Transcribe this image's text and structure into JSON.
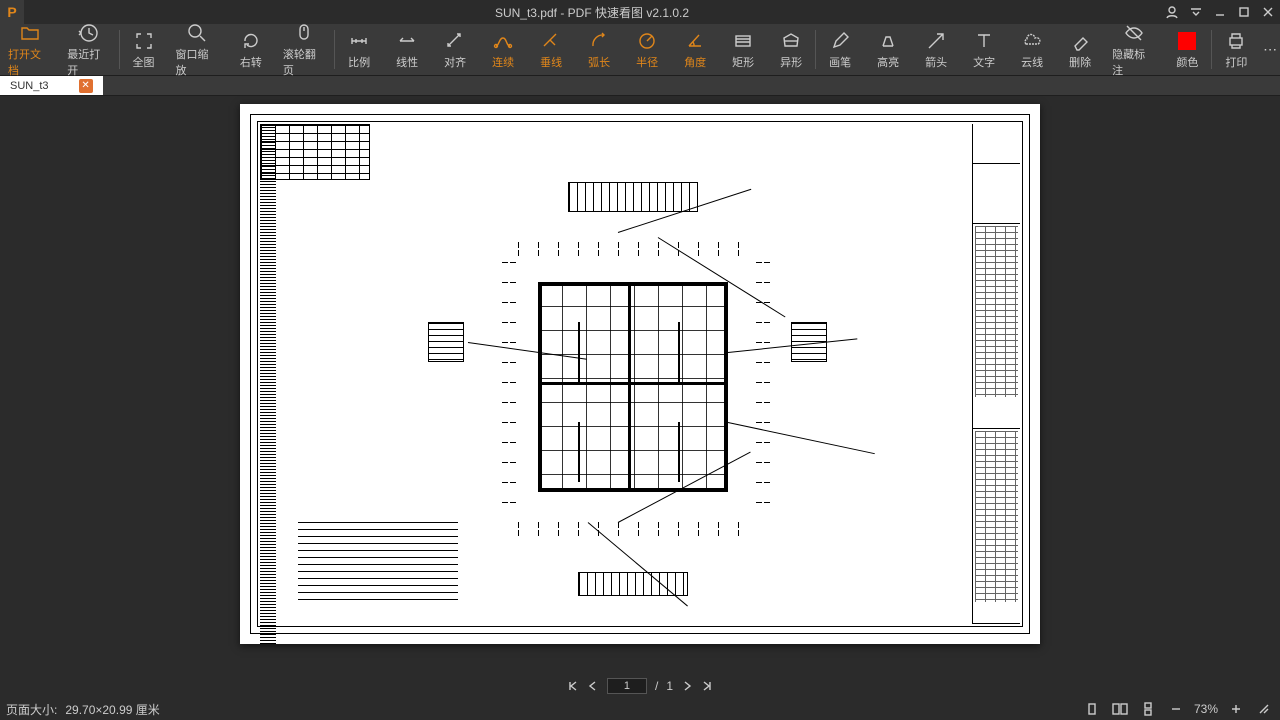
{
  "window": {
    "title": "SUN_t3.pdf - PDF 快速看图 v2.1.0.2"
  },
  "toolbar": {
    "open": "打开文档",
    "recent": "最近打开",
    "fit": "全图",
    "zoomwin": "窗口缩放",
    "rotate": "右转",
    "scrollpage": "滚轮翻页",
    "scale": "比例",
    "linear": "线性",
    "align": "对齐",
    "poly": "连续",
    "vline": "垂线",
    "arc": "弧长",
    "radius": "半径",
    "angle": "角度",
    "rect": "矩形",
    "irregular": "异形",
    "pen": "画笔",
    "highlight": "高亮",
    "arrow": "箭头",
    "text": "文字",
    "cloud": "云线",
    "delete": "删除",
    "hideannot": "隐藏标注",
    "color": "颜色",
    "print": "打印",
    "color_value": "#ff0000"
  },
  "tab": {
    "name": "SUN_t3"
  },
  "nav": {
    "current_page": "1",
    "total_pages": "1",
    "sep": "/"
  },
  "status": {
    "pagesize_label": "页面大小:",
    "pagesize_value": "29.70×20.99 厘米",
    "zoom": "73%"
  }
}
